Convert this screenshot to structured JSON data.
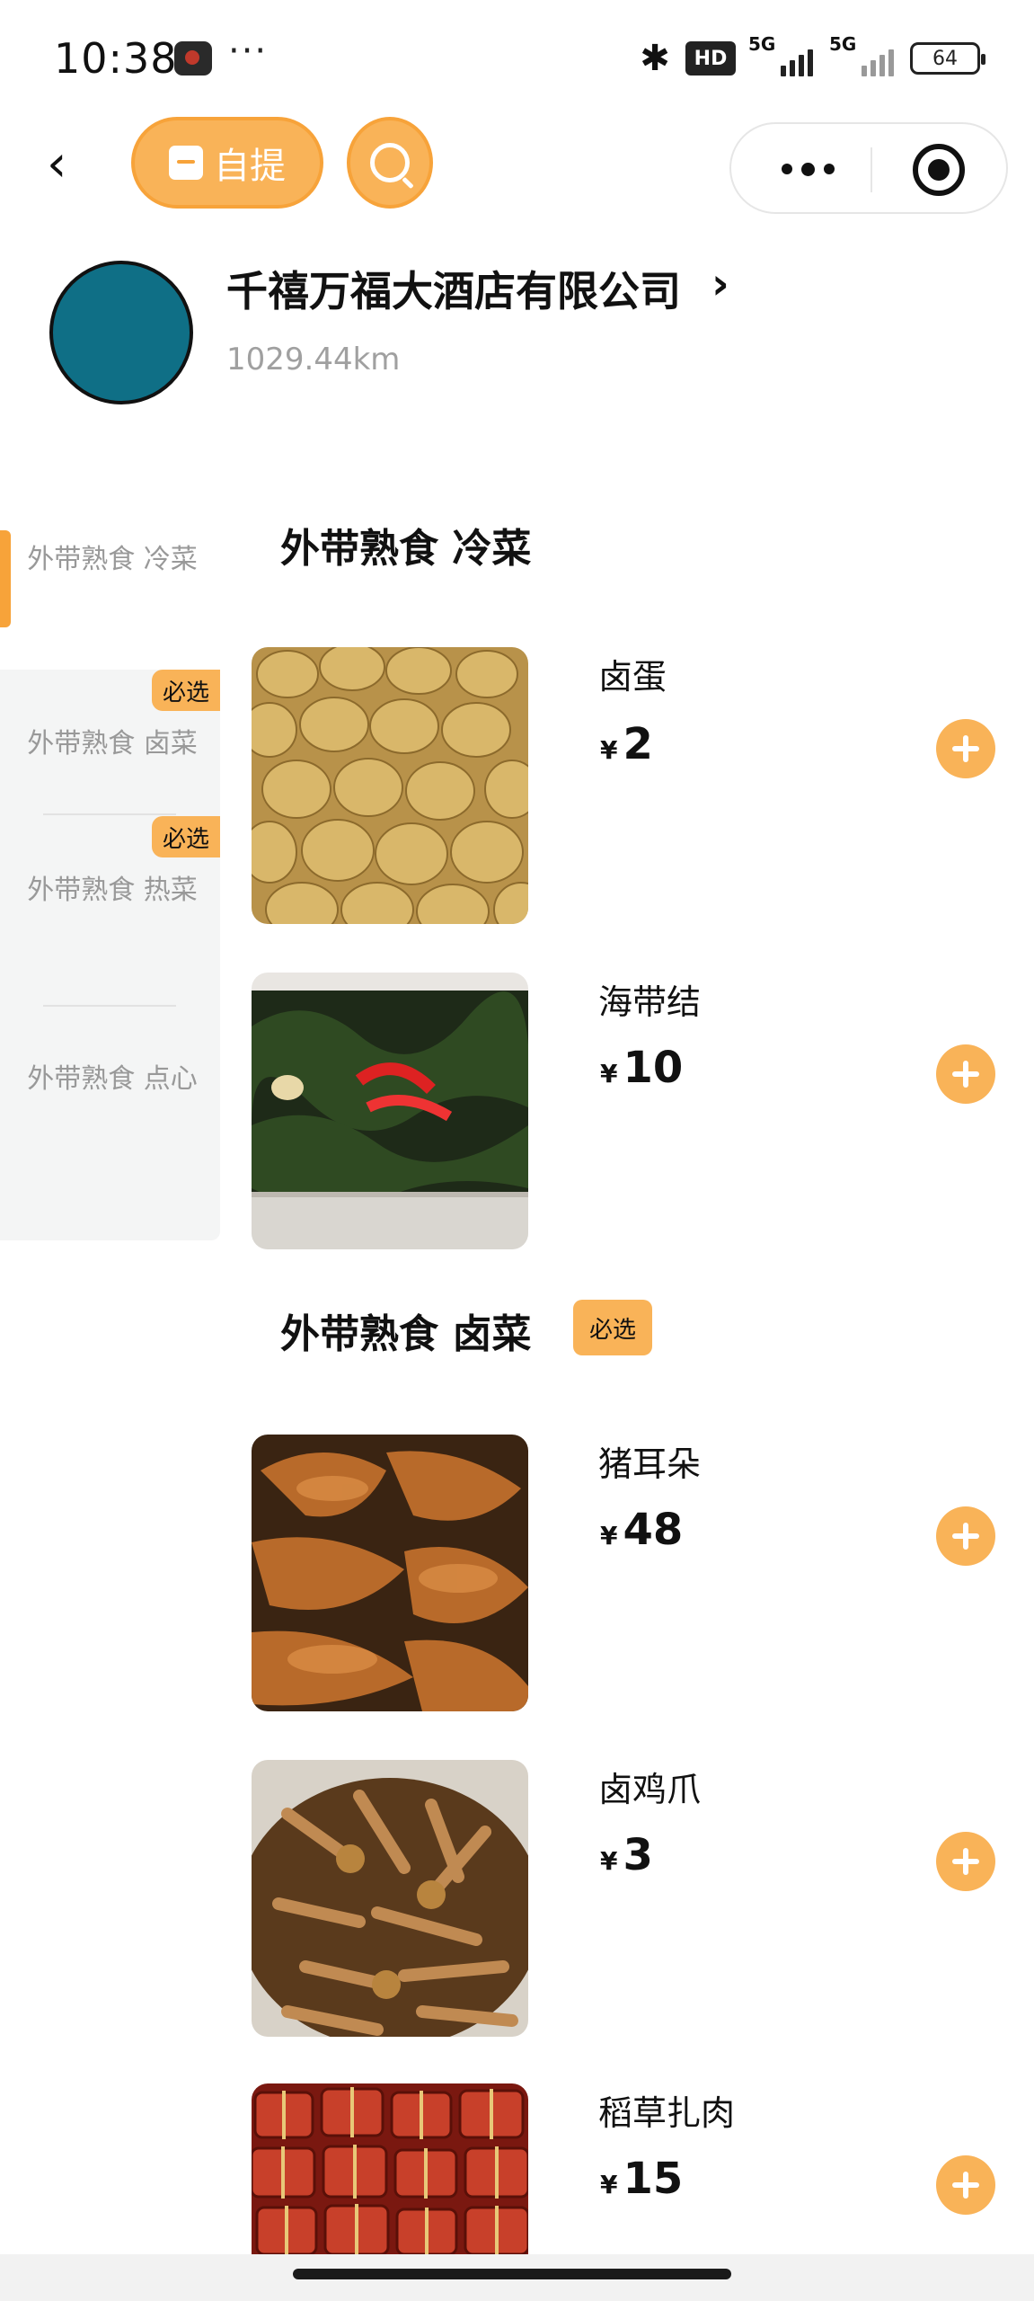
{
  "status_bar": {
    "time": "10:38",
    "more": "···",
    "bluetooth_icon": "bluetooth-icon",
    "hd_label": "HD",
    "signal_1_label": "5G",
    "signal_2_label": "5G",
    "battery_level": "64"
  },
  "nav": {
    "pickup_label": "自提",
    "search_icon": "search-icon",
    "back_icon": "back-arrow-icon"
  },
  "store": {
    "name": "千禧万福大酒店有限公司",
    "distance": "1029.44km"
  },
  "sidebar": {
    "categories": [
      {
        "label": "外带熟食 冷菜",
        "badge": ""
      },
      {
        "label": "外带熟食 卤菜",
        "badge": "必选"
      },
      {
        "label": "外带熟食 热菜",
        "badge": "必选"
      },
      {
        "label": "外带熟食 点心",
        "badge": ""
      }
    ]
  },
  "sections": [
    {
      "title": "外带熟食 冷菜",
      "badge": "",
      "items": [
        {
          "name": "卤蛋",
          "currency": "¥",
          "price": "2",
          "image": "braised-eggs-photo"
        },
        {
          "name": "海带结",
          "currency": "¥",
          "price": "10",
          "image": "kelp-knots-photo"
        }
      ]
    },
    {
      "title": "外带熟食 卤菜",
      "badge": "必选",
      "items": [
        {
          "name": "猪耳朵",
          "currency": "¥",
          "price": "48",
          "image": "pig-ears-photo"
        },
        {
          "name": "卤鸡爪",
          "currency": "¥",
          "price": "3",
          "image": "braised-chicken-feet-photo"
        },
        {
          "name": "稻草扎肉",
          "currency": "¥",
          "price": "15",
          "image": "straw-tied-pork-photo"
        }
      ]
    }
  ],
  "colors": {
    "accent": "#f9b358",
    "accent_border": "#f7a33a",
    "logo": "#0f6f86",
    "sidebar_bg": "#f4f5f5",
    "muted_text": "#999999"
  }
}
